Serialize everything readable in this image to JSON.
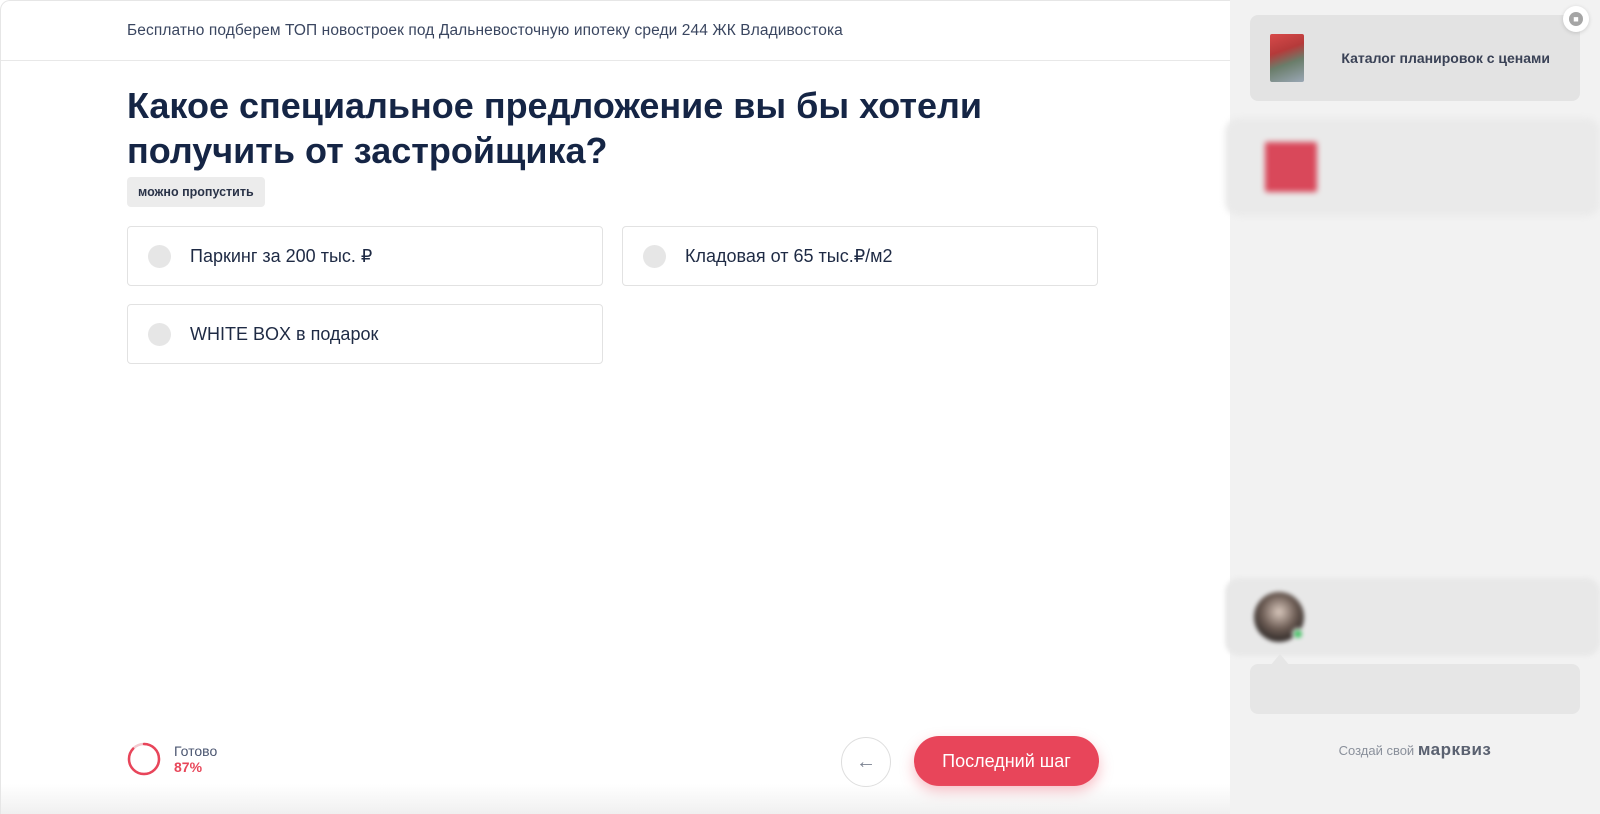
{
  "header": {
    "subtitle": "Бесплатно подберем ТОП новостроек под Дальневосточную ипотеку среди 244 ЖК Владивостока"
  },
  "question": {
    "title": "Какое специальное предложение вы бы хотели получить от застройщика?",
    "skip_label": "можно пропустить"
  },
  "options": [
    {
      "label": "Паркинг за 200 тыс. ₽",
      "selected": false
    },
    {
      "label": "Кладовая от 65 тыс.₽/м2",
      "selected": false
    },
    {
      "label": "WHITE BOX в подарок",
      "selected": false
    }
  ],
  "footer": {
    "progress_label": "Готово",
    "progress_value": "87%",
    "progress_fraction": 0.87,
    "back_icon": "arrow-left-icon",
    "next_label": "Последний шаг"
  },
  "sidebar": {
    "bonus_1": "Каталог планировок с ценами",
    "brand_prefix": "Создай свой",
    "brand_name": "марквиз"
  },
  "colors": {
    "accent": "#e8455a",
    "text_dark": "#152545",
    "sidebar_bg": "#f2f2f2"
  }
}
